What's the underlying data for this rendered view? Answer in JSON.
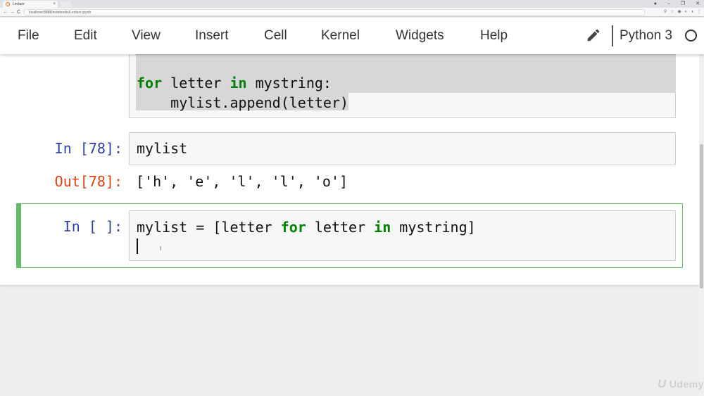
{
  "browser": {
    "tab_title": "Lecture",
    "tab_close": "×",
    "url": "localhost:8888/notebooks/Lecture.ipynb",
    "window_buttons": [
      "●",
      "–",
      "❐",
      "✕"
    ],
    "nav": {
      "back": "←",
      "forward": "→",
      "reload": "C"
    },
    "url_icons": [
      "⚲",
      "☆",
      "◉",
      "◐",
      "◑",
      "⋮"
    ]
  },
  "menubar": {
    "items": [
      "File",
      "Edit",
      "View",
      "Insert",
      "Cell",
      "Kernel",
      "Widgets",
      "Help"
    ],
    "kernel_name": "Python 3",
    "icons": {
      "edit": "pencil-icon",
      "kernel_status": "kernel-idle-circle-icon"
    }
  },
  "cells": [
    {
      "lines": [
        {
          "kw1": "for",
          "a": " letter ",
          "kw2": "in",
          "b": " mystring:"
        },
        "    mylist.append(letter)"
      ]
    },
    {
      "prompt_in": "In [78]:",
      "code": "mylist",
      "prompt_out": "Out[78]:",
      "output": "['h', 'e', 'l', 'l', 'o']"
    },
    {
      "prompt_in": "In [ ]:",
      "code_parts": [
        "mylist = [letter ",
        "for",
        " letter ",
        "in",
        " mystring]"
      ]
    }
  ],
  "watermark": {
    "mark": "U",
    "text": "Udemy"
  },
  "colors": {
    "keyword": "#008000",
    "in_prompt": "#303f9f",
    "out_prompt": "#d84315",
    "active_cell": "#66bb6a"
  }
}
